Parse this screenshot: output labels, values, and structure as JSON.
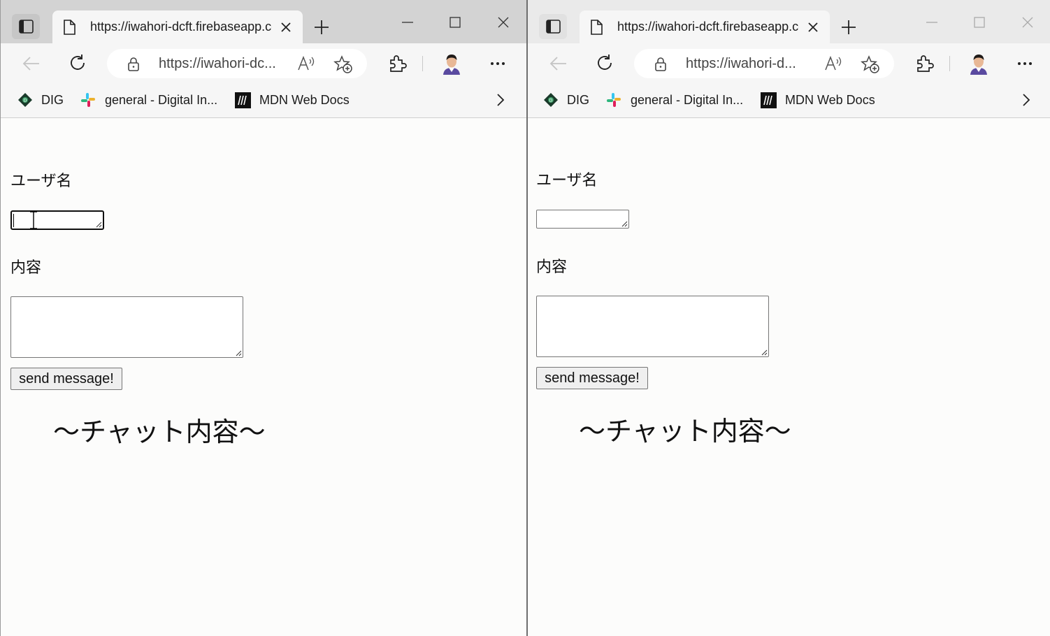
{
  "browser": {
    "tab_title": "https://iwahori-dcft.firebaseapp.com",
    "address_text": "https://iwahori-dc...",
    "favorites": [
      {
        "label": "DIG",
        "icon": "dig-logo-icon"
      },
      {
        "label": "general - Digital In...",
        "icon": "slack-icon"
      },
      {
        "label": "MDN Web Docs",
        "icon": "mdn-icon"
      }
    ]
  },
  "browser_right": {
    "address_text": "https://iwahori-d..."
  },
  "form": {
    "username_label": "ユーザ名",
    "username_value": "",
    "content_label": "内容",
    "content_value": "",
    "send_label": "send message!"
  },
  "chat": {
    "title": "～チャット内容～"
  },
  "colors": {
    "tabbar_active": "#d3d3d3",
    "tabbar_inactive": "#eaeaea",
    "toolbar": "#f6f6f6",
    "page_background": "#fcfcfb"
  }
}
